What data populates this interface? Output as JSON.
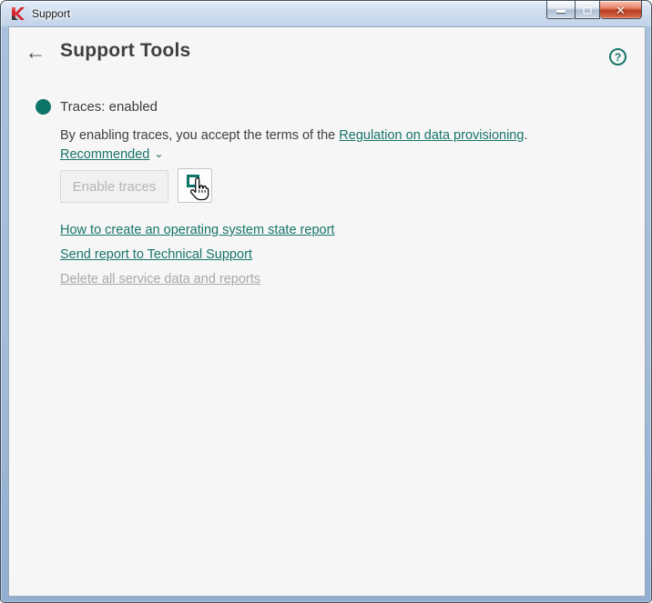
{
  "window": {
    "title": "Support",
    "controls": {
      "close_glyph": "✕"
    }
  },
  "header": {
    "back_arrow": "←",
    "title": "Support Tools",
    "help_glyph": "?"
  },
  "status": {
    "text": "Traces: enabled"
  },
  "terms": {
    "prefix": "By enabling traces, you accept the terms of the ",
    "link": "Regulation on data provisioning",
    "suffix": ".",
    "recommended_label": "Recommended",
    "chevron": "⌄"
  },
  "buttons": {
    "enable_traces": "Enable traces"
  },
  "links": [
    {
      "label": "How to create an operating system state report",
      "enabled": true
    },
    {
      "label": "Send report to Technical Support",
      "enabled": true
    },
    {
      "label": "Delete all service data and reports",
      "enabled": false
    }
  ],
  "colors": {
    "accent_teal": "#17756a",
    "status_dot": "#0d7467",
    "title_text": "#3f3f3f",
    "disabled_button_text": "#b4b4b4",
    "disabled_link": "#a8a8a8",
    "client_background": "#f6f6f6"
  }
}
